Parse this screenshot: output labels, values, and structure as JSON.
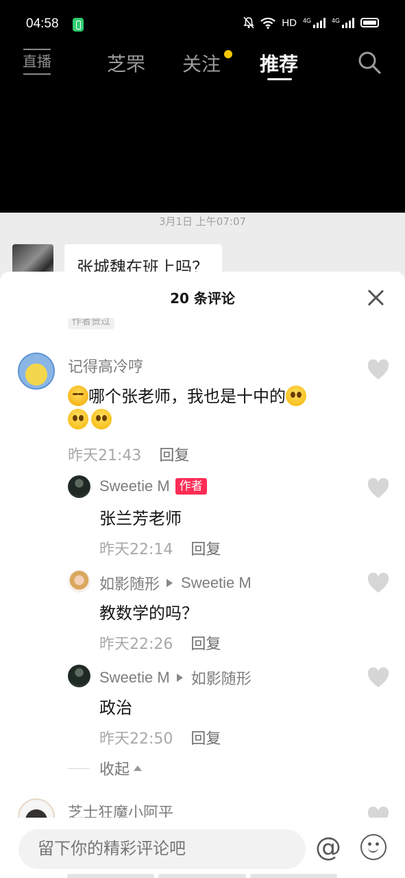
{
  "status_bar": {
    "time": "04:58",
    "hd_label": "HD",
    "net_label_1": "4G",
    "net_label_2": "4G"
  },
  "top_nav": {
    "live_label": "直播",
    "tabs": [
      {
        "label": "芝罘"
      },
      {
        "label": "关注"
      },
      {
        "label": "推荐"
      }
    ],
    "active_tab": "推荐",
    "dot_color": "#f8c800"
  },
  "chat": {
    "timestamp": "3月1日 上午07:07",
    "message": "张城魏在班上吗？"
  },
  "sheet": {
    "title": "20 条评论",
    "author_liked_label": "作者赞过",
    "comments": [
      {
        "user": "记得高冷哼",
        "text": "哪个张老师，我也是十中的",
        "time": "昨天21:43",
        "reply_label": "回复"
      },
      {
        "user": "Sweetie M",
        "badge": "作者",
        "text": "张兰芳老师",
        "time": "昨天22:14",
        "reply_label": "回复"
      },
      {
        "user": "如影随形",
        "reply_to": "Sweetie M",
        "text": "教数学的吗？",
        "time": "昨天22:26",
        "reply_label": "回复"
      },
      {
        "user": "Sweetie M",
        "reply_to": "如影随形",
        "text": "政治",
        "time": "昨天22:50",
        "reply_label": "回复"
      },
      {
        "user": "芝士狂魔小阿平"
      }
    ],
    "collapse_label": "收起"
  },
  "input": {
    "placeholder": "留下你的精彩评论吧",
    "at_label": "@"
  },
  "colors": {
    "badge": "#fe2c55",
    "heart": "#d6d6d6"
  }
}
